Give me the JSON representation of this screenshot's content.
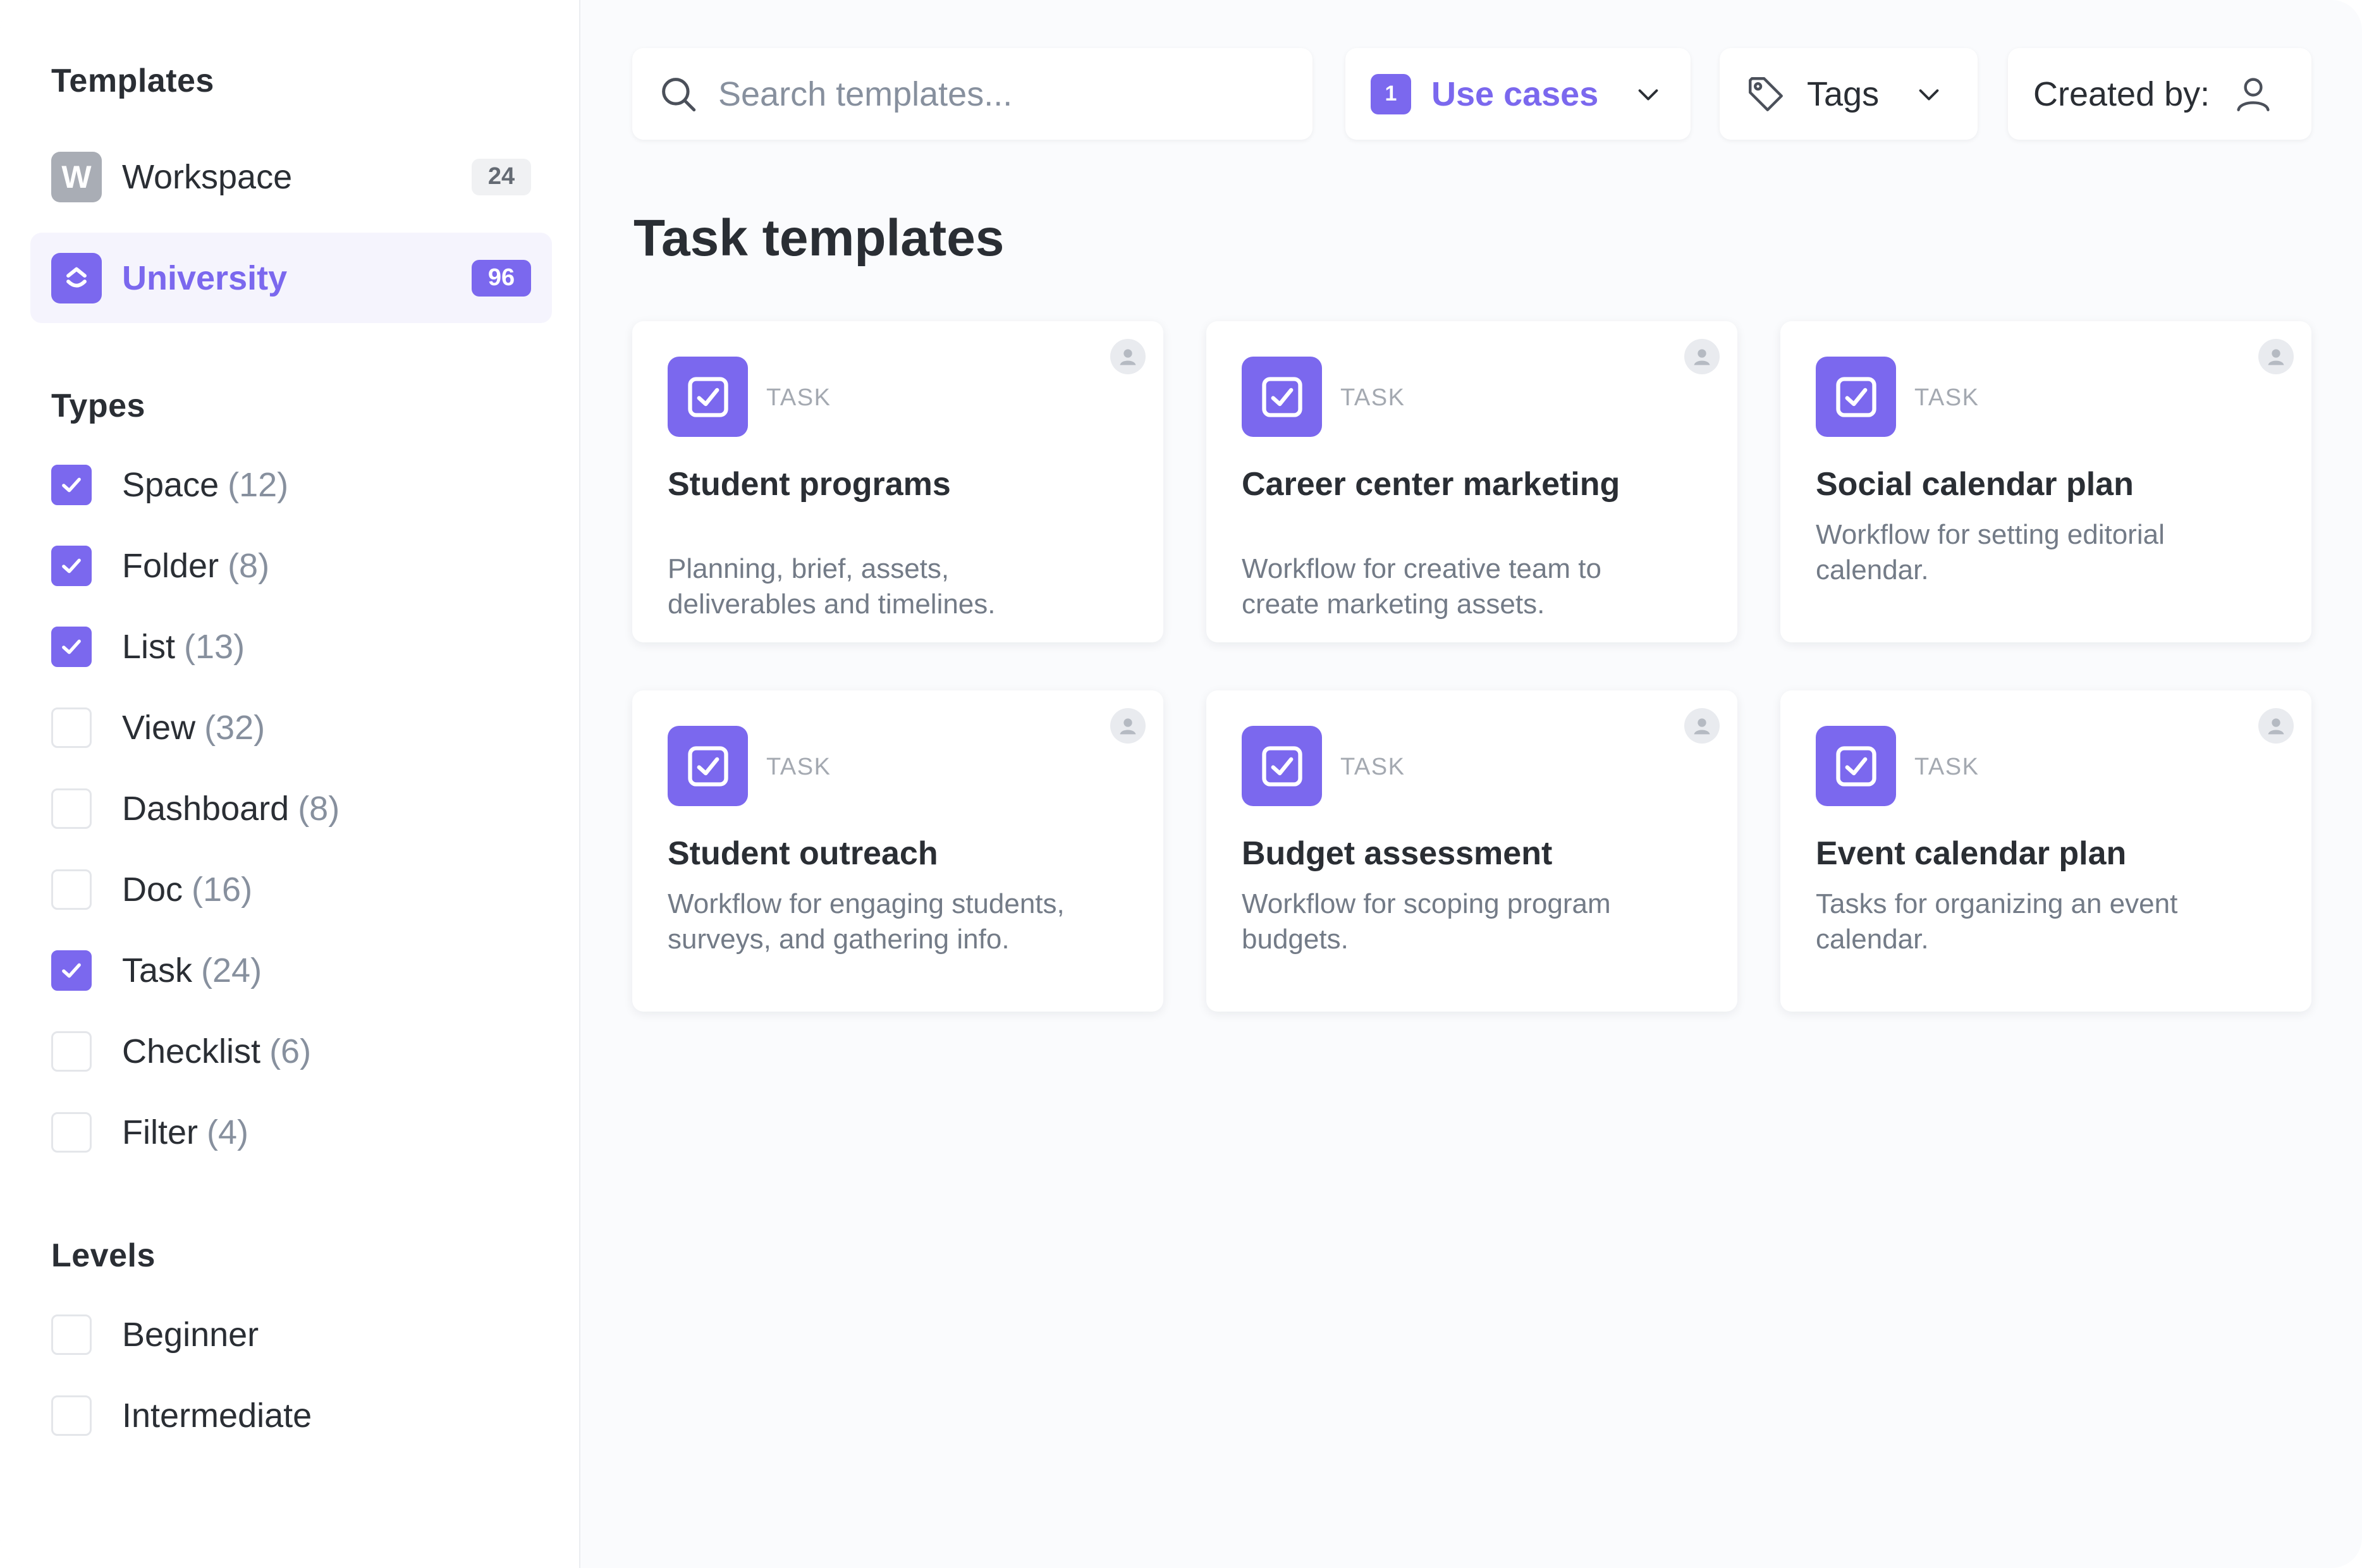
{
  "sidebar": {
    "templates_heading": "Templates",
    "workspaces": [
      {
        "initial": "W",
        "label": "Workspace",
        "count": "24",
        "active": false
      },
      {
        "initial": "",
        "label": "University",
        "count": "96",
        "active": true
      }
    ],
    "types_heading": "Types",
    "types": [
      {
        "label": "Space",
        "count": "(12)",
        "checked": true
      },
      {
        "label": "Folder",
        "count": "(8)",
        "checked": true
      },
      {
        "label": "List",
        "count": "(13)",
        "checked": true
      },
      {
        "label": "View",
        "count": "(32)",
        "checked": false
      },
      {
        "label": "Dashboard",
        "count": "(8)",
        "checked": false
      },
      {
        "label": "Doc",
        "count": "(16)",
        "checked": false
      },
      {
        "label": "Task",
        "count": "(24)",
        "checked": true
      },
      {
        "label": "Checklist",
        "count": "(6)",
        "checked": false
      },
      {
        "label": "Filter",
        "count": "(4)",
        "checked": false
      }
    ],
    "levels_heading": "Levels",
    "levels": [
      {
        "label": "Beginner",
        "checked": false
      },
      {
        "label": "Intermediate",
        "checked": false
      }
    ]
  },
  "toolbar": {
    "search_placeholder": "Search templates...",
    "use_cases_badge": "1",
    "use_cases_label": "Use cases",
    "tags_label": "Tags",
    "created_by_label": "Created by:"
  },
  "main": {
    "title": "Task templates",
    "cards": [
      {
        "type": "TASK",
        "title": "Student programs",
        "desc_line1": "Planning, brief, assets,",
        "desc_line2": "deliverables and timelines."
      },
      {
        "type": "TASK",
        "title": "Career center marketing",
        "desc_line1": "Workflow for creative team to",
        "desc_line2": "create marketing assets."
      },
      {
        "type": "TASK",
        "title": "Social calendar plan",
        "desc_line1": "Workflow for setting editorial",
        "desc_line2": "calendar."
      },
      {
        "type": "TASK",
        "title": "Student outreach",
        "desc_line1": "Workflow for engaging students,",
        "desc_line2": "surveys, and gathering info."
      },
      {
        "type": "TASK",
        "title": "Budget assessment",
        "desc_line1": "Workflow for scoping program",
        "desc_line2": "budgets."
      },
      {
        "type": "TASK",
        "title": "Event calendar plan",
        "desc_line1": "Tasks for organizing an event",
        "desc_line2": "calendar."
      }
    ]
  },
  "colors": {
    "accent": "#7b68ee",
    "accent_bg": "#f5f4fd",
    "text": "#2a2e34",
    "muted": "#87909e"
  }
}
